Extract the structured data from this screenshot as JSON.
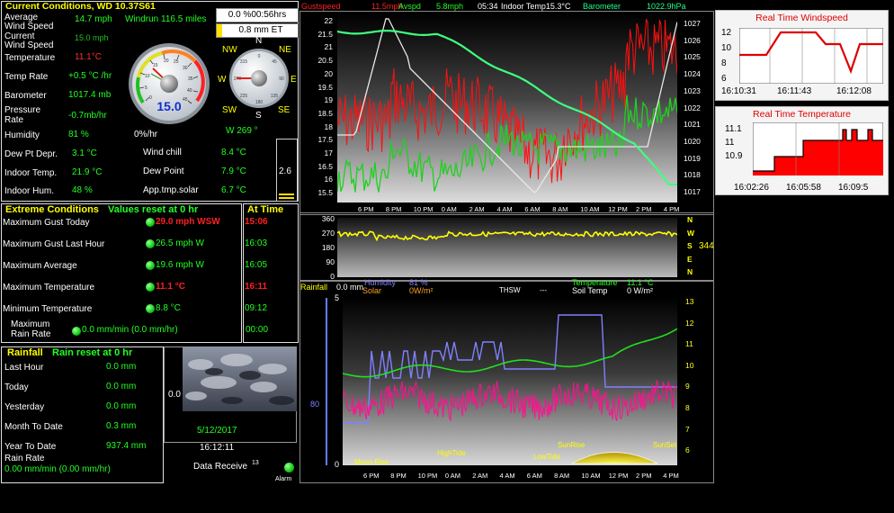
{
  "current": {
    "title": "Current Conditions, WD 10.37S61",
    "avg_label": "Average",
    "wind_speed_label": "Wind Speed",
    "avg_value": "14.7 mph",
    "windrun": "Windrun 116.5 miles",
    "current_label": "Current",
    "current_wind": "15.0 mph",
    "temperature_label": "Temperature",
    "temperature_value": "11.1°C",
    "temp_rate_label": "Temp Rate",
    "temp_rate_value": "+0.5 °C /hr",
    "barometer_label": "Barometer",
    "barometer_value": "1017.4 mb",
    "pressure_label": "Pressure",
    "rate_label": "Rate",
    "pressure_rate_value": "-0.7mb/hr",
    "humidity_label": "Humidity",
    "humidity_value": "81 %",
    "humidity_rate": "0%/hr",
    "wind_dir": "W  269 °",
    "dewpt_label": "Dew Pt Depr.",
    "dewpt_value": "3.1 °C",
    "windchill_label": "Wind chill",
    "windchill_value": "8.4 °C",
    "indoor_temp_label": "Indoor Temp.",
    "indoor_temp_value": "21.9 °C",
    "dewpoint_label": "Dew Point",
    "dewpoint_value": "7.9 °C",
    "indoor_hum_label": "Indoor Hum.",
    "indoor_hum_value": "48 %",
    "apptmp_label": "App.tmp.solar",
    "apptmp_value": "6.7 °C",
    "gauge_value": "15.0",
    "timer": "0.0 %00:56hrs",
    "et": "0.8 mm ET",
    "solar_box": "2.6"
  },
  "compass": {
    "n": "N",
    "ne": "NE",
    "e": "E",
    "se": "SE",
    "s": "S",
    "sw": "SW",
    "w": "W",
    "nw": "NW"
  },
  "extreme": {
    "title": "Extreme Conditions",
    "reset": "Values reset at 0 hr",
    "at_time": "At Time",
    "rows": [
      {
        "label": "Maximum Gust Today",
        "value": "29.0 mph WSW",
        "time": "15:06",
        "red": true
      },
      {
        "label": "Maximum Gust Last Hour",
        "value": "26.5 mph  W",
        "time": "16:03",
        "red": false
      },
      {
        "label": "Maximum Average",
        "value": "19.6 mph W",
        "time": "16:05",
        "red": false
      },
      {
        "label": "Maximum Temperature",
        "value": "11.1 °C",
        "time": "16:11",
        "red": true
      },
      {
        "label": "Minimum Temperature",
        "value": "8.8 °C",
        "time": "09:12",
        "red": false
      }
    ],
    "max_rain_label1": "Maximum",
    "max_rain_label2": "Rain Rate",
    "max_rain_value": "0.0 mm/min (0.0 mm/hr)",
    "max_rain_time": "00:00"
  },
  "rainfall": {
    "title": "Rainfall",
    "reset": "Rain reset at 0 hr",
    "rows": [
      {
        "label": "Last Hour",
        "value": "0.0 mm"
      },
      {
        "label": "Today",
        "value": "0.0 mm"
      },
      {
        "label": "Yesterday",
        "value": "0.0 mm"
      },
      {
        "label": "Month To Date",
        "value": "0.3 mm"
      },
      {
        "label": "Year To Date",
        "value": "937.4 mm"
      }
    ],
    "rate_label": "Rain Rate",
    "rate_value": "0.00 mm/min (0.00 mm/hr)",
    "cam_zero": "0.0",
    "date": "5/12/2017",
    "time": "16:12:11",
    "data_received": "Data Receive",
    "data_count": "13",
    "alarm": "Alarm"
  },
  "graph_top": {
    "header_gust": "Gustspeed",
    "header_gust_val": "11.5mph",
    "header_avg": "Avspd",
    "header_avg_val": "5.8mph",
    "header_time": "05:34",
    "header_indoor": "Indoor Temp15.3°C",
    "header_baro": "Barometer",
    "header_baro_val": "1022.9hPa",
    "left_ticks": [
      "22",
      "21.5",
      "21",
      "20.5",
      "20",
      "19.5",
      "19",
      "18.5",
      "18",
      "17.5",
      "17",
      "16.5",
      "16",
      "15.5"
    ],
    "right_ticks": [
      "1027",
      "1026",
      "1025",
      "1024",
      "1023",
      "1022",
      "1021",
      "1020",
      "1019",
      "1018",
      "1017"
    ],
    "x_ticks": [
      "6 PM",
      "8 PM",
      "10 PM",
      "0 AM",
      "2 AM",
      "4 AM",
      "6 AM",
      "8 AM",
      "10 AM",
      "12 PM",
      "2 PM",
      "4 PM"
    ]
  },
  "graph_dir": {
    "ticks": [
      "360",
      "270",
      "180",
      "90",
      "0"
    ],
    "right_letters": [
      "N",
      "W",
      "S",
      "E",
      "N"
    ],
    "value": "344"
  },
  "graph_bottom": {
    "rainfall": "Rainfall",
    "rainfall_val": "0.0 mm",
    "humidity": "Humidity",
    "humidity_val": "81 %",
    "solar": "Solar",
    "solar_val": "0W/m²",
    "thsw": "THSW",
    "thsw_val": "---",
    "temperature": "Temperature",
    "temperature_val": "11.1 °C",
    "soil": "Soil Temp",
    "soil_val": "0 W/m²",
    "left_top": "5",
    "left_zero": "0",
    "hum_axis": "80",
    "right_ticks": [
      "13",
      "12",
      "11",
      "10",
      "9",
      "8",
      "7",
      "6"
    ],
    "x_ticks": [
      "6 PM",
      "8 PM",
      "10 PM",
      "0 AM",
      "2 AM",
      "4 AM",
      "6 AM",
      "8 AM",
      "10 AM",
      "12 PM",
      "2 PM",
      "4 PM"
    ],
    "moonrise": "Moon Rise",
    "hightide": "HighTide",
    "lowtide": "LowTide",
    "sunrise": "SunRise",
    "sunset": "SunSet"
  },
  "rt_wind": {
    "title": "Real Time Windspeed",
    "ticks": [
      "12",
      "10",
      "8",
      "6"
    ],
    "x": [
      "16:10:31",
      "16:11:43",
      "16:12:08"
    ]
  },
  "rt_temp": {
    "title": "Real Time Temperature",
    "ticks": [
      "11.1",
      "11",
      "10.9"
    ],
    "x": [
      "16:02:26",
      "16:05:58",
      "16:09:5"
    ]
  },
  "colors": {
    "yellow": "#ffff00",
    "green": "#22ff22",
    "red": "#ff2020",
    "gust": "#ff1010",
    "avg": "#20e020",
    "indoor": "#e0e0e0",
    "baro": "#40ff80",
    "pink": "#ff1090",
    "blue": "#8080ff"
  }
}
